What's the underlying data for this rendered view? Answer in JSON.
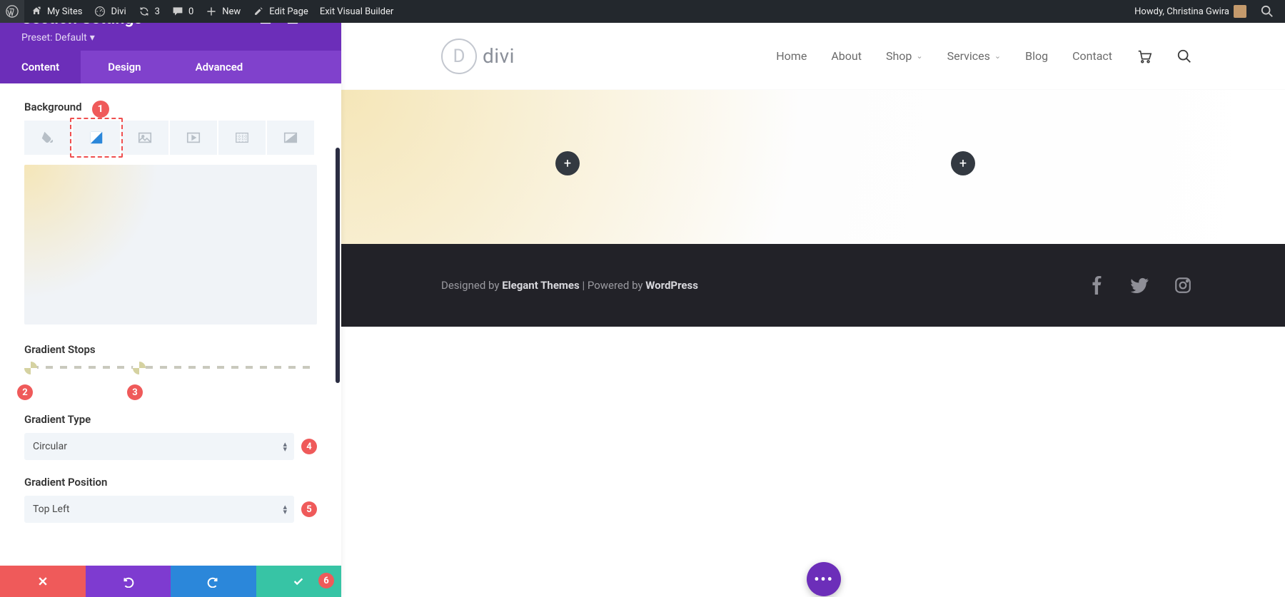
{
  "adminbar": {
    "mysites": "My Sites",
    "sitename": "Divi",
    "updates": "3",
    "comments": "0",
    "new": "New",
    "editpage": "Edit Page",
    "exitvb": "Exit Visual Builder",
    "howdy": "Howdy, Christina Gwira"
  },
  "panel": {
    "title": "Section Settings",
    "preset_label": "Preset: Default",
    "tabs": {
      "content": "Content",
      "design": "Design",
      "advanced": "Advanced"
    },
    "background_label": "Background",
    "stops_label": "Gradient Stops",
    "type_label": "Gradient Type",
    "type_value": "Circular",
    "position_label": "Gradient Position",
    "position_value": "Top Left",
    "badges": {
      "b1": "1",
      "b2": "2",
      "b3": "3",
      "b4": "4",
      "b5": "5",
      "b6": "6"
    }
  },
  "nav": {
    "home": "Home",
    "about": "About",
    "shop": "Shop",
    "services": "Services",
    "blog": "Blog",
    "contact": "Contact"
  },
  "logo": {
    "text": "divi"
  },
  "footer": {
    "designed_by": "Designed by ",
    "brand": "Elegant Themes",
    "sep": " | Powered by ",
    "platform": "WordPress"
  }
}
